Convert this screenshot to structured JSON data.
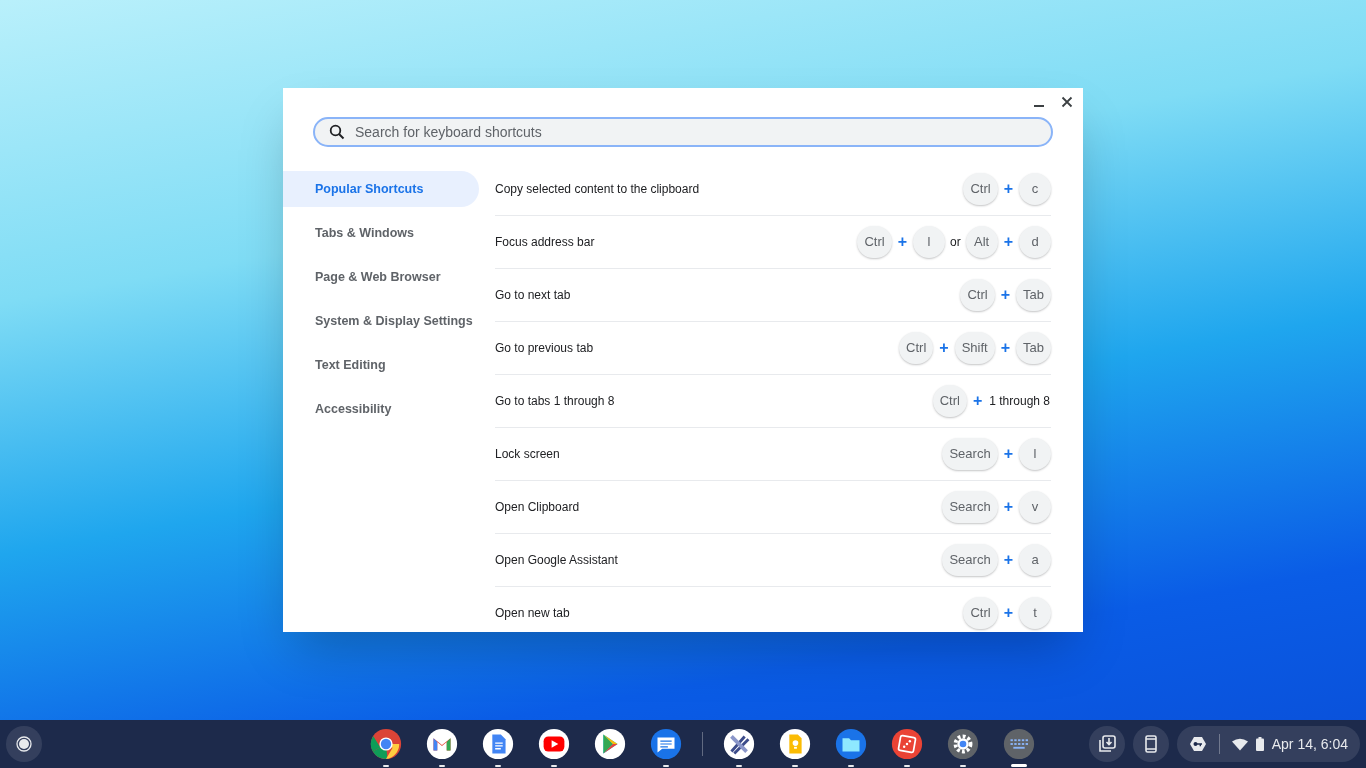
{
  "search": {
    "placeholder": "Search for keyboard shortcuts"
  },
  "categories": [
    {
      "label": "Popular Shortcuts",
      "selected": true
    },
    {
      "label": "Tabs & Windows",
      "selected": false
    },
    {
      "label": "Page & Web Browser",
      "selected": false
    },
    {
      "label": "System & Display Settings",
      "selected": false
    },
    {
      "label": "Text Editing",
      "selected": false
    },
    {
      "label": "Accessibility",
      "selected": false
    }
  ],
  "shortcuts": [
    {
      "description": "Copy selected content to the clipboard",
      "keys": [
        {
          "kind": "key",
          "text": "Ctrl"
        },
        {
          "kind": "plus",
          "text": "+"
        },
        {
          "kind": "key",
          "text": "c"
        }
      ]
    },
    {
      "description": "Focus address bar",
      "keys": [
        {
          "kind": "key",
          "text": "Ctrl"
        },
        {
          "kind": "plus",
          "text": "+"
        },
        {
          "kind": "key",
          "text": "l"
        },
        {
          "kind": "word",
          "text": "or"
        },
        {
          "kind": "key",
          "text": "Alt"
        },
        {
          "kind": "plus",
          "text": "+"
        },
        {
          "kind": "key",
          "text": "d"
        }
      ]
    },
    {
      "description": "Go to next tab",
      "keys": [
        {
          "kind": "key",
          "text": "Ctrl"
        },
        {
          "kind": "plus",
          "text": "+"
        },
        {
          "kind": "key",
          "text": "Tab"
        }
      ]
    },
    {
      "description": "Go to previous tab",
      "keys": [
        {
          "kind": "key",
          "text": "Ctrl"
        },
        {
          "kind": "plus",
          "text": "+"
        },
        {
          "kind": "key",
          "text": "Shift"
        },
        {
          "kind": "plus",
          "text": "+"
        },
        {
          "kind": "key",
          "text": "Tab"
        }
      ]
    },
    {
      "description": "Go to tabs 1 through 8",
      "keys": [
        {
          "kind": "key",
          "text": "Ctrl"
        },
        {
          "kind": "plus",
          "text": "+"
        },
        {
          "kind": "word",
          "text": "1 through 8"
        }
      ]
    },
    {
      "description": "Lock screen",
      "keys": [
        {
          "kind": "key",
          "text": "Search"
        },
        {
          "kind": "plus",
          "text": "+"
        },
        {
          "kind": "key",
          "text": "l"
        }
      ]
    },
    {
      "description": "Open Clipboard",
      "keys": [
        {
          "kind": "key",
          "text": "Search"
        },
        {
          "kind": "plus",
          "text": "+"
        },
        {
          "kind": "key",
          "text": "v"
        }
      ]
    },
    {
      "description": "Open Google Assistant",
      "keys": [
        {
          "kind": "key",
          "text": "Search"
        },
        {
          "kind": "plus",
          "text": "+"
        },
        {
          "kind": "key",
          "text": "a"
        }
      ]
    },
    {
      "description": "Open new tab",
      "keys": [
        {
          "kind": "key",
          "text": "Ctrl"
        },
        {
          "kind": "plus",
          "text": "+"
        },
        {
          "kind": "key",
          "text": "t"
        }
      ]
    }
  ],
  "shelf": {
    "apps": [
      {
        "kind": "chrome",
        "running": true,
        "active": false
      },
      {
        "kind": "gmail",
        "running": true,
        "active": false
      },
      {
        "kind": "docs",
        "running": true,
        "active": false
      },
      {
        "kind": "youtube",
        "running": true,
        "active": false
      },
      {
        "kind": "play",
        "running": false,
        "active": false
      },
      {
        "kind": "messages",
        "running": true,
        "active": false
      },
      {
        "kind": "separator"
      },
      {
        "kind": "sketch",
        "running": true,
        "active": false
      },
      {
        "kind": "keep",
        "running": true,
        "active": false
      },
      {
        "kind": "files",
        "running": true,
        "active": false
      },
      {
        "kind": "dice",
        "running": true,
        "active": false
      },
      {
        "kind": "settings",
        "running": true,
        "active": false
      },
      {
        "kind": "keyboard",
        "running": true,
        "active": true
      }
    ],
    "date_time": "Apr 14, 6:04"
  }
}
